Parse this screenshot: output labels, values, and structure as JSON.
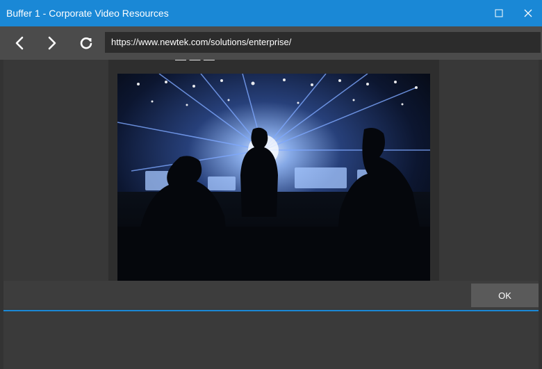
{
  "window": {
    "title": "Buffer 1 - Corporate Video Resources",
    "maximize_icon": "maximize-icon",
    "close_icon": "close-icon"
  },
  "toolbar": {
    "back_icon": "chevron-left-icon",
    "forward_icon": "chevron-right-icon",
    "reload_icon": "reload-icon",
    "url": "https://www.newtek.com/solutions/enterprise/"
  },
  "page": {
    "image_description_icon": "photo-live-production-control-room"
  },
  "dialog": {
    "ok_label": "OK"
  },
  "colors": {
    "accent": "#1a88d6",
    "toolbar": "#4b4b4b",
    "background": "#3a3a3a"
  }
}
